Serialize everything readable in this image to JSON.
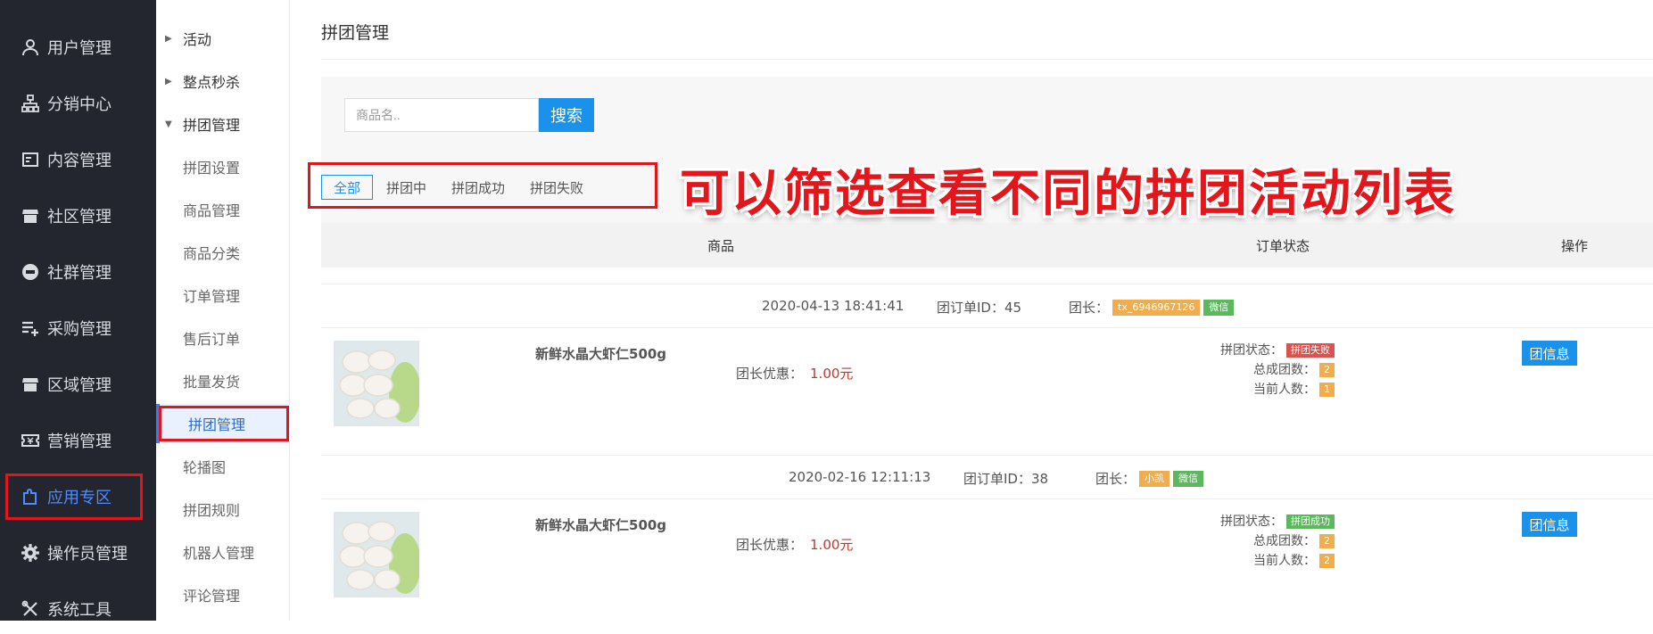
{
  "left_nav": {
    "items": [
      {
        "label": "用户管理",
        "icon": "user-icon"
      },
      {
        "label": "分销中心",
        "icon": "hierarchy-icon"
      },
      {
        "label": "内容管理",
        "icon": "document-icon"
      },
      {
        "label": "社区管理",
        "icon": "store-icon"
      },
      {
        "label": "社群管理",
        "icon": "minus-circle-icon"
      },
      {
        "label": "采购管理",
        "icon": "list-add-icon"
      },
      {
        "label": "区域管理",
        "icon": "store-icon"
      },
      {
        "label": "营销管理",
        "icon": "ticket-icon"
      },
      {
        "label": "应用专区",
        "icon": "puzzle-icon"
      },
      {
        "label": "操作员管理",
        "icon": "gear-icon"
      },
      {
        "label": "系统工具",
        "icon": "tools-icon"
      }
    ]
  },
  "sub_nav": {
    "items": [
      {
        "label": "活动"
      },
      {
        "label": "整点秒杀"
      },
      {
        "label": "拼团管理"
      },
      {
        "label": "拼团设置"
      },
      {
        "label": "商品管理"
      },
      {
        "label": "商品分类"
      },
      {
        "label": "订单管理"
      },
      {
        "label": "售后订单"
      },
      {
        "label": "批量发货"
      },
      {
        "label": "拼团管理"
      },
      {
        "label": "轮播图"
      },
      {
        "label": "拼团规则"
      },
      {
        "label": "机器人管理"
      },
      {
        "label": "评论管理"
      }
    ]
  },
  "main": {
    "title": "拼团管理",
    "search": {
      "placeholder": "商品名..",
      "button": "搜索"
    },
    "tabs": [
      "全部",
      "拼团中",
      "拼团成功",
      "拼团失败"
    ],
    "annotation": "可以筛选查看不同的拼团活动列表",
    "table": {
      "headers": {
        "product": "商品",
        "status": "订单状态",
        "action": "操作"
      },
      "groups": [
        {
          "time": "2020-04-13 18:41:41",
          "order_id_label": "团订单ID：",
          "order_id": "45",
          "leader_label": "团长：",
          "leader_name": "tx_6946967126",
          "leader_source": "微信",
          "product_name": "新鲜水晶大虾仁500g",
          "discount_label": "团长优惠：",
          "discount_value": "1.00元",
          "status_label": "拼团状态：",
          "status_value": "拼团失败",
          "total_label": "总成团数：",
          "total_value": "2",
          "current_label": "当前人数：",
          "current_value": "1",
          "button": "团信息"
        },
        {
          "time": "2020-02-16 12:11:13",
          "order_id_label": "团订单ID：",
          "order_id": "38",
          "leader_label": "团长：",
          "leader_name": "小凯",
          "leader_source": "微信",
          "product_name": "新鲜水晶大虾仁500g",
          "discount_label": "团长优惠：",
          "discount_value": "1.00元",
          "status_label": "拼团状态：",
          "status_value": "拼团成功",
          "total_label": "总成团数：",
          "total_value": "2",
          "current_label": "当前人数：",
          "current_value": "2",
          "button": "团信息"
        }
      ]
    }
  },
  "colors": {
    "nav_bg": "#23262e",
    "primary": "#1a91eb",
    "annotation_red": "#e3161b",
    "badge_orange": "#f0ad4e",
    "badge_green": "#5cb85c",
    "badge_red": "#d9534f"
  }
}
